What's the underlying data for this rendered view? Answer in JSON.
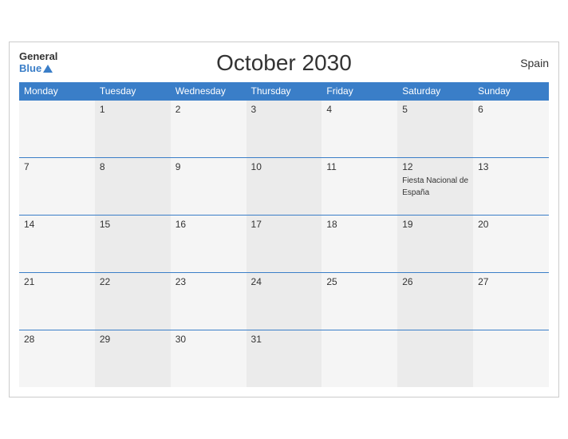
{
  "header": {
    "logo_general": "General",
    "logo_blue": "Blue",
    "title": "October 2030",
    "country": "Spain"
  },
  "weekdays": [
    "Monday",
    "Tuesday",
    "Wednesday",
    "Thursday",
    "Friday",
    "Saturday",
    "Sunday"
  ],
  "weeks": [
    [
      {
        "day": "",
        "events": []
      },
      {
        "day": "1",
        "events": []
      },
      {
        "day": "2",
        "events": []
      },
      {
        "day": "3",
        "events": []
      },
      {
        "day": "4",
        "events": []
      },
      {
        "day": "5",
        "events": []
      },
      {
        "day": "6",
        "events": []
      }
    ],
    [
      {
        "day": "7",
        "events": []
      },
      {
        "day": "8",
        "events": []
      },
      {
        "day": "9",
        "events": []
      },
      {
        "day": "10",
        "events": []
      },
      {
        "day": "11",
        "events": []
      },
      {
        "day": "12",
        "events": [
          "Fiesta Nacional de España"
        ]
      },
      {
        "day": "13",
        "events": []
      }
    ],
    [
      {
        "day": "14",
        "events": []
      },
      {
        "day": "15",
        "events": []
      },
      {
        "day": "16",
        "events": []
      },
      {
        "day": "17",
        "events": []
      },
      {
        "day": "18",
        "events": []
      },
      {
        "day": "19",
        "events": []
      },
      {
        "day": "20",
        "events": []
      }
    ],
    [
      {
        "day": "21",
        "events": []
      },
      {
        "day": "22",
        "events": []
      },
      {
        "day": "23",
        "events": []
      },
      {
        "day": "24",
        "events": []
      },
      {
        "day": "25",
        "events": []
      },
      {
        "day": "26",
        "events": []
      },
      {
        "day": "27",
        "events": []
      }
    ],
    [
      {
        "day": "28",
        "events": []
      },
      {
        "day": "29",
        "events": []
      },
      {
        "day": "30",
        "events": []
      },
      {
        "day": "31",
        "events": []
      },
      {
        "day": "",
        "events": []
      },
      {
        "day": "",
        "events": []
      },
      {
        "day": "",
        "events": []
      }
    ]
  ]
}
